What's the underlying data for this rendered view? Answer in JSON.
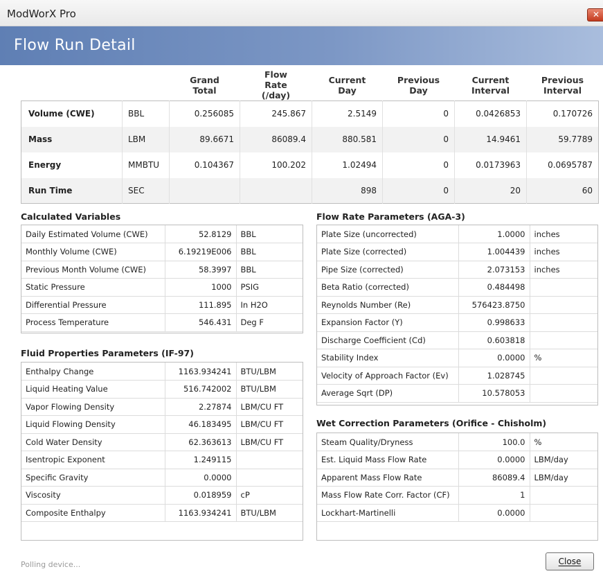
{
  "window": {
    "title": "ModWorX Pro",
    "close_glyph": "✕"
  },
  "banner": {
    "title": "Flow Run Detail"
  },
  "summary": {
    "headers": [
      "",
      "",
      "Grand Total",
      "Flow Rate (/day)",
      "Current Day",
      "Previous Day",
      "Current Interval",
      "Previous Interval"
    ],
    "rows": [
      {
        "label": "Volume (CWE)",
        "unit": "BBL",
        "values": [
          "0.256085",
          "245.867",
          "2.5149",
          "0",
          "0.0426853",
          "0.170726"
        ]
      },
      {
        "label": "Mass",
        "unit": "LBM",
        "values": [
          "89.6671",
          "86089.4",
          "880.581",
          "0",
          "14.9461",
          "59.7789"
        ]
      },
      {
        "label": "Energy",
        "unit": "MMBTU",
        "values": [
          "0.104367",
          "100.202",
          "1.02494",
          "0",
          "0.0173963",
          "0.0695787"
        ]
      },
      {
        "label": "Run Time",
        "unit": "SEC",
        "values": [
          "",
          "",
          "898",
          "0",
          "20",
          "60"
        ]
      }
    ]
  },
  "calculated": {
    "title": "Calculated Variables",
    "rows": [
      {
        "name": "Daily Estimated Volume (CWE)",
        "value": "52.8129",
        "unit": "BBL"
      },
      {
        "name": "Monthly Volume (CWE)",
        "value": "6.19219E006",
        "unit": "BBL"
      },
      {
        "name": "Previous Month Volume (CWE)",
        "value": "58.3997",
        "unit": "BBL"
      },
      {
        "name": "Static Pressure",
        "value": "1000",
        "unit": "PSIG"
      },
      {
        "name": "Differential Pressure",
        "value": "111.895",
        "unit": "In H2O"
      },
      {
        "name": "Process Temperature",
        "value": "546.431",
        "unit": "Deg F"
      }
    ]
  },
  "fluid": {
    "title": "Fluid Properties Parameters (IF-97)",
    "rows": [
      {
        "name": "Enthalpy Change",
        "value": "1163.934241",
        "unit": "BTU/LBM"
      },
      {
        "name": "Liquid Heating Value",
        "value": "516.742002",
        "unit": "BTU/LBM"
      },
      {
        "name": "Vapor Flowing Density",
        "value": "2.27874",
        "unit": "LBM/CU FT"
      },
      {
        "name": "Liquid Flowing Density",
        "value": "46.183495",
        "unit": "LBM/CU FT"
      },
      {
        "name": "Cold Water Density",
        "value": "62.363613",
        "unit": "LBM/CU FT"
      },
      {
        "name": "Isentropic Exponent",
        "value": "1.249115",
        "unit": ""
      },
      {
        "name": "Specific Gravity",
        "value": "0.0000",
        "unit": ""
      },
      {
        "name": "Viscosity",
        "value": "0.018959",
        "unit": "cP"
      },
      {
        "name": "Composite Enthalpy",
        "value": "1163.934241",
        "unit": "BTU/LBM"
      }
    ]
  },
  "flowrate": {
    "title": "Flow Rate Parameters (AGA-3)",
    "rows": [
      {
        "name": "Plate Size (uncorrected)",
        "value": "1.0000",
        "unit": "inches"
      },
      {
        "name": "Plate Size (corrected)",
        "value": "1.004439",
        "unit": "inches"
      },
      {
        "name": "Pipe Size (corrected)",
        "value": "2.073153",
        "unit": "inches"
      },
      {
        "name": "Beta Ratio (corrected)",
        "value": "0.484498",
        "unit": ""
      },
      {
        "name": "Reynolds Number (Re)",
        "value": "576423.8750",
        "unit": ""
      },
      {
        "name": "Expansion Factor (Y)",
        "value": "0.998633",
        "unit": ""
      },
      {
        "name": "Discharge Coefficient (Cd)",
        "value": "0.603818",
        "unit": ""
      },
      {
        "name": "Stability Index",
        "value": "0.0000",
        "unit": "%"
      },
      {
        "name": "Velocity of Approach Factor (Ev)",
        "value": "1.028745",
        "unit": ""
      },
      {
        "name": "Average Sqrt (DP)",
        "value": "10.578053",
        "unit": ""
      }
    ]
  },
  "wet": {
    "title": "Wet Correction Parameters (Orifice - Chisholm)",
    "rows": [
      {
        "name": "Steam Quality/Dryness",
        "value": "100.0",
        "unit": "%"
      },
      {
        "name": "Est. Liquid Mass Flow Rate",
        "value": "0.0000",
        "unit": "LBM/day"
      },
      {
        "name": "Apparent Mass Flow Rate",
        "value": "86089.4",
        "unit": "LBM/day"
      },
      {
        "name": "Mass Flow Rate Corr. Factor (CF)",
        "value": "1",
        "unit": ""
      },
      {
        "name": "Lockhart-Martinelli",
        "value": "0.0000",
        "unit": ""
      }
    ]
  },
  "footer": {
    "status": "Polling device...",
    "close_label": "Close"
  }
}
